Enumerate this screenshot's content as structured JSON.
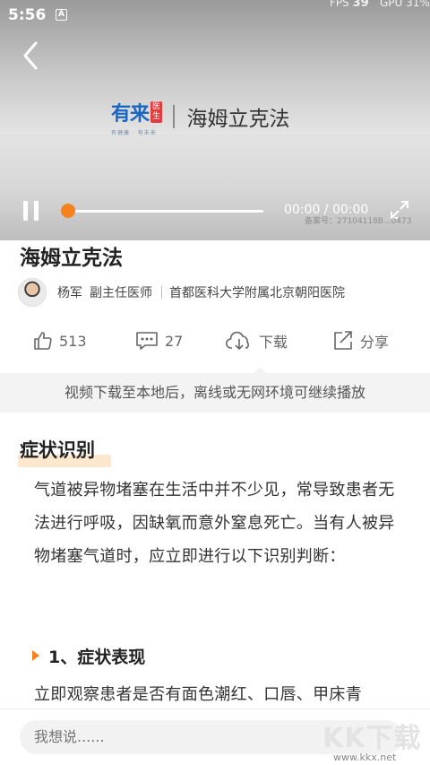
{
  "statusbar": {
    "time": "5:56",
    "notif": "A",
    "fps_label": "FPS",
    "fps_value": "39",
    "gpu_label": "GPU 31%"
  },
  "video": {
    "brand_name": "有来",
    "brand_tag": "医生",
    "brand_slogan": "有健康 · 有未来",
    "video_title": "海姆立克法",
    "time": "00:00 / 00:00",
    "progress": 0,
    "record_no": "备案号：27104118B...0473"
  },
  "article": {
    "title": "海姆立克法",
    "author_name": "杨军",
    "author_title": "副主任医师",
    "hospital": "首都医科大学附属北京朝阳医院"
  },
  "actions": {
    "likes": "513",
    "comments": "27",
    "download": "下载",
    "share": "分享"
  },
  "notice": "视频下载至本地后，离线或无网环境可继续播放",
  "content": {
    "section_title": "症状识别",
    "paragraph": "气道被异物堵塞在生活中并不少见，常导致患者无法进行呼吸，因缺氧而意外窒息死亡。当有人被异物堵塞气道时，应立即进行以下识别判断：",
    "subheading": "1、症状表现",
    "paragraph2": "立即观察患者是否有面色潮红、口唇、甲床青"
  },
  "comment_input": {
    "placeholder": "我想说......"
  },
  "watermark": {
    "brand": "KK下载",
    "url": "www.kkx.net"
  },
  "colors": {
    "accent": "#f5821f",
    "brand_blue": "#1a66c2",
    "brand_red": "#e23b3b",
    "highlight": "#fde7cf"
  }
}
